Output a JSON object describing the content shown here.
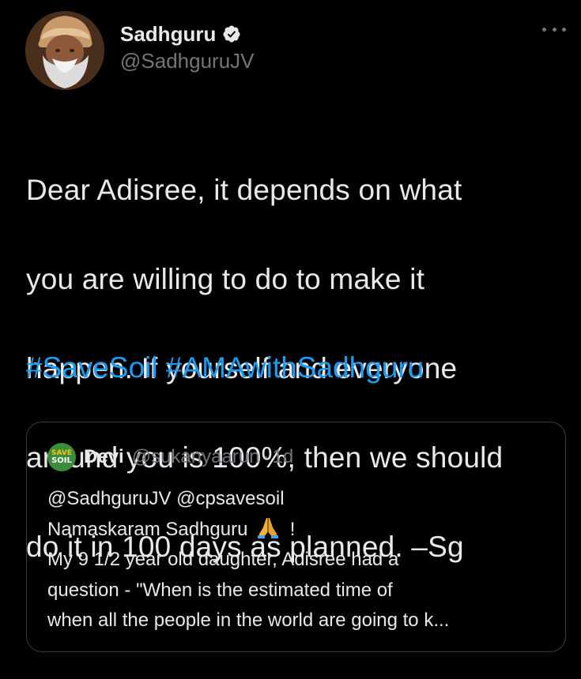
{
  "tweet": {
    "author": {
      "display_name": "Sadhguru",
      "handle": "@SadhguruJV",
      "verified": true,
      "avatar_icon": "profile-photo"
    },
    "more_icon": "more-options-icon",
    "text_lines": [
      "Dear Adisree, it depends on what",
      "you are willing to do to make it",
      "happen. If yourself and everyone",
      "around you is 100%, then we should",
      "do it in 100 days as planned. –Sg"
    ],
    "hashtags": [
      "#SaveSoil",
      "#AMAwithSadhguru"
    ]
  },
  "quoted_tweet": {
    "author": {
      "display_name": "Devi",
      "handle": "@sukanyaarun",
      "avatar_text_top": "SAVE",
      "avatar_text_bottom": "SOIL"
    },
    "separator": "·",
    "time": "1d",
    "lines": {
      "mentions": "@SadhguruJV @cpsavesoil",
      "greeting": "Namaskaram Sadhguru",
      "greeting_end": "!",
      "line3": "My 9 1/2 year old daughter, Adisree had a",
      "line4": "question - \"When is the estimated time of",
      "line5": "when all the people in the world are going to k..."
    }
  },
  "colors": {
    "background": "#000000",
    "text_primary": "#e7e9ea",
    "text_secondary": "#71767b",
    "link": "#1d9bf0",
    "border": "#3a3d41",
    "verified_badge": "#e7e9ea"
  }
}
